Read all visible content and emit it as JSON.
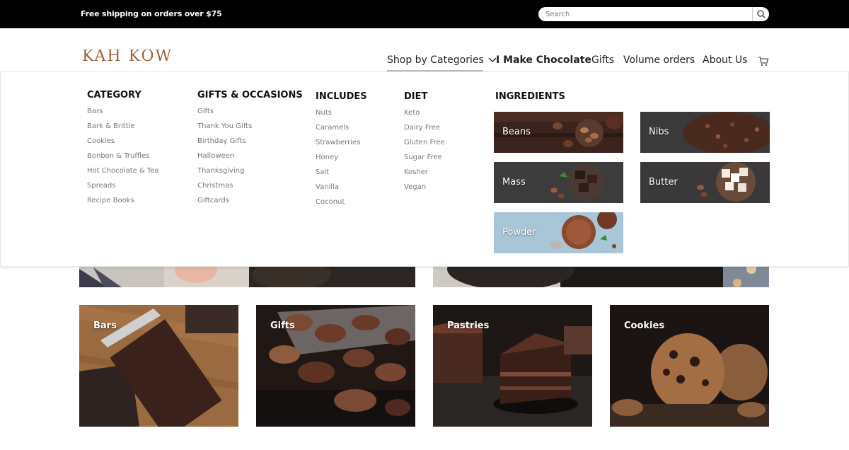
{
  "topbar": {
    "shipping_text": "Free shipping on orders over $75",
    "search_placeholder": "Search"
  },
  "header": {
    "logo_text": "KAH KOW",
    "nav": [
      "Shop by Categories",
      "I Make Chocolate",
      "Gifts",
      "Volume orders",
      "About Us"
    ]
  },
  "menu": {
    "category": {
      "title": "CATEGORY",
      "items": [
        "Bars",
        "Bark & Brittle",
        "Cookies",
        "Bonbon & Truffles",
        "Hot Chocolate & Tea",
        "Spreads",
        "Recipe Books"
      ]
    },
    "gifts": {
      "title": "GIFTS & OCCASIONS",
      "items": [
        "Gifts",
        "Thank You Gifts",
        "Birthday Gifts",
        "Halloween",
        "Thanksgiving",
        "Christmas",
        "Giftcards"
      ]
    },
    "includes": {
      "title": "INCLUDES",
      "items": [
        "Nuts",
        "Caramels",
        "Strawberries",
        "Honey",
        "Salt",
        "Vanilla",
        "Coconut"
      ]
    },
    "diet": {
      "title": "DIET",
      "items": [
        "Keto",
        "Dairy Free",
        "Gluten Free",
        "Sugar Free",
        "Kosher",
        "Vegan"
      ]
    },
    "ingredients": {
      "title": "INGREDIENTS",
      "tiles": [
        "Beans",
        "Nibs",
        "Mass",
        "Butter",
        "Powder"
      ]
    }
  },
  "cards": [
    "Bars",
    "Gifts",
    "Pastries",
    "Cookies"
  ],
  "colors": {
    "topbar": "#000000",
    "accent_logo": "#a0623a",
    "panel_bg": "#ffffff"
  }
}
